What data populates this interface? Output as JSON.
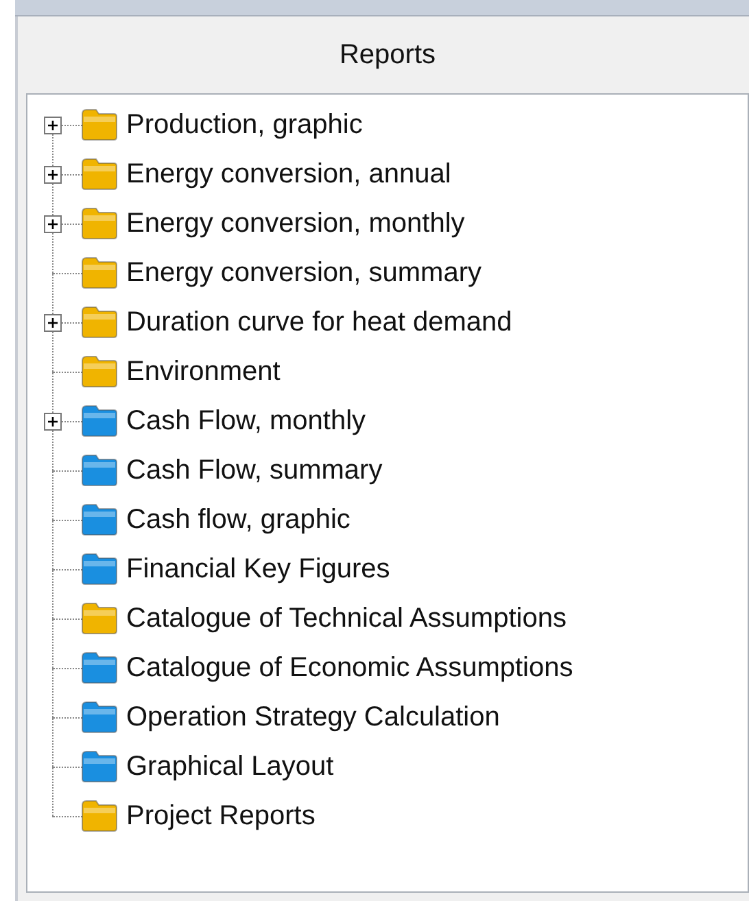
{
  "panel": {
    "title": "Reports"
  },
  "tree": {
    "items": [
      {
        "label": "Production, graphic",
        "kind": "group",
        "color": "#f0b400"
      },
      {
        "label": "Energy conversion, annual",
        "kind": "group",
        "color": "#f0b400"
      },
      {
        "label": "Energy conversion, monthly",
        "kind": "group",
        "color": "#f0b400"
      },
      {
        "label": "Energy conversion, summary",
        "kind": "leaf",
        "color": "#f0b400"
      },
      {
        "label": "Duration curve for heat demand",
        "kind": "group",
        "color": "#f0b400"
      },
      {
        "label": "Environment",
        "kind": "leaf",
        "color": "#f0b400"
      },
      {
        "label": "Cash Flow, monthly",
        "kind": "group",
        "color": "#1a8fe0"
      },
      {
        "label": "Cash Flow, summary",
        "kind": "leaf",
        "color": "#1a8fe0"
      },
      {
        "label": "Cash flow, graphic",
        "kind": "leaf",
        "color": "#1a8fe0"
      },
      {
        "label": "Financial Key Figures",
        "kind": "leaf",
        "color": "#1a8fe0"
      },
      {
        "label": "Catalogue of Technical Assumptions",
        "kind": "leaf",
        "color": "#f0b400"
      },
      {
        "label": "Catalogue of Economic Assumptions",
        "kind": "leaf",
        "color": "#1a8fe0"
      },
      {
        "label": "Operation Strategy Calculation",
        "kind": "leaf",
        "color": "#1a8fe0"
      },
      {
        "label": "Graphical Layout",
        "kind": "leaf",
        "color": "#1a8fe0"
      },
      {
        "label": "Project Reports",
        "kind": "leaf",
        "color": "#f0b400"
      }
    ]
  }
}
